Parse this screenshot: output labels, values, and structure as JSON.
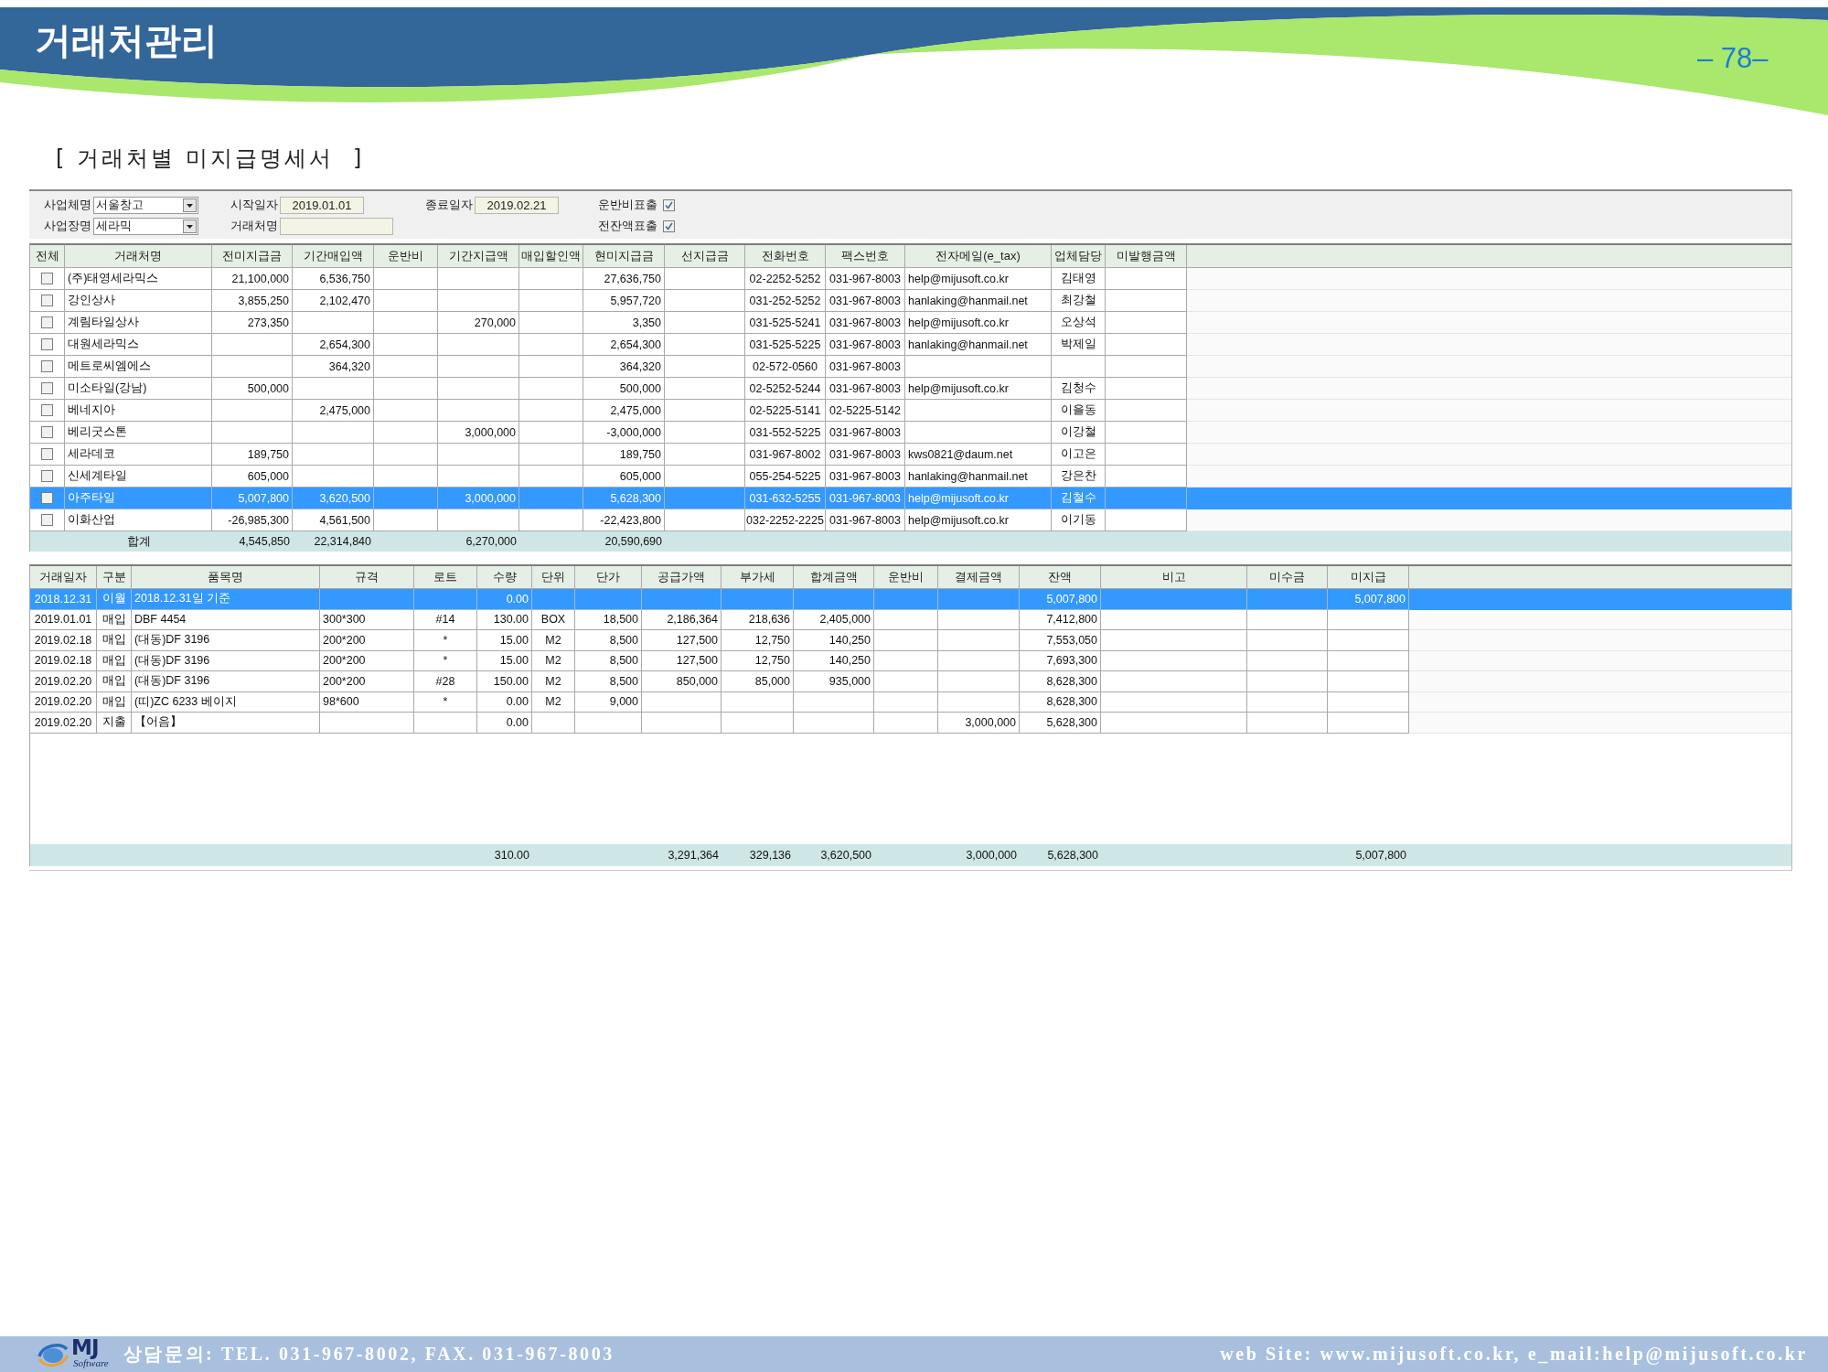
{
  "header": {
    "title": "거래처관리",
    "page_number": "– 78–"
  },
  "section_title": "[ 거래처별 미지급명세서  ]",
  "filter_columns": [
    {
      "fields": [
        {
          "kind": "combo",
          "label": "사업체명",
          "value": "서울창고"
        },
        {
          "kind": "combo",
          "label": "사업장명",
          "value": "세라믹"
        }
      ]
    },
    {
      "fields": [
        {
          "kind": "date",
          "label": "시작일자",
          "value": "2019.01.01"
        },
        {
          "kind": "text",
          "label": "거래처명"
        }
      ]
    },
    {
      "fields": [
        {
          "kind": "date",
          "label": "종료일자",
          "value": "2019.02.21"
        }
      ]
    },
    {
      "fields": [
        {
          "kind": "checkbox",
          "label": "운반비표출",
          "checked": true
        },
        {
          "kind": "checkbox",
          "label": "전잔액표출",
          "checked": true
        }
      ]
    }
  ],
  "vendor_table": {
    "columns": [
      "전체",
      "거래처명",
      "전미지급금",
      "기간매입액",
      "운반비",
      "기간지급액",
      "매입할인액",
      "현미지급금",
      "선지급금",
      "전화번호",
      "팩스번호",
      "전자메일(e_tax)",
      "업체담당",
      "미발행금액"
    ],
    "rows": [
      {
        "checked": false,
        "selected": false,
        "cells": [
          "",
          "(주)태영세라믹스",
          "21,100,000",
          "6,536,750",
          "",
          "",
          "",
          "27,636,750",
          "",
          "02-2252-5252",
          "031-967-8003",
          "help@mijusoft.co.kr",
          "김태영",
          ""
        ]
      },
      {
        "checked": false,
        "selected": false,
        "cells": [
          "",
          "강인상사",
          "3,855,250",
          "2,102,470",
          "",
          "",
          "",
          "5,957,720",
          "",
          "031-252-5252",
          "031-967-8003",
          "hanlaking@hanmail.net",
          "최강철",
          ""
        ]
      },
      {
        "checked": false,
        "selected": false,
        "cells": [
          "",
          "계림타일상사",
          "273,350",
          "",
          "",
          "270,000",
          "",
          "3,350",
          "",
          "031-525-5241",
          "031-967-8003",
          "help@mijusoft.co.kr",
          "오상석",
          ""
        ]
      },
      {
        "checked": false,
        "selected": false,
        "cells": [
          "",
          "대원세라믹스",
          "",
          "2,654,300",
          "",
          "",
          "",
          "2,654,300",
          "",
          "031-525-5225",
          "031-967-8003",
          "hanlaking@hanmail.net",
          "박제일",
          ""
        ]
      },
      {
        "checked": false,
        "selected": false,
        "cells": [
          "",
          "메트로씨엠에스",
          "",
          "364,320",
          "",
          "",
          "",
          "364,320",
          "",
          "02-572-0560",
          "031-967-8003",
          "",
          "",
          ""
        ]
      },
      {
        "checked": false,
        "selected": false,
        "cells": [
          "",
          "미소타일(강남)",
          "500,000",
          "",
          "",
          "",
          "",
          "500,000",
          "",
          "02-5252-5244",
          "031-967-8003",
          "help@mijusoft.co.kr",
          "김청수",
          ""
        ]
      },
      {
        "checked": false,
        "selected": false,
        "cells": [
          "",
          "베네지아",
          "",
          "2,475,000",
          "",
          "",
          "",
          "2,475,000",
          "",
          "02-5225-5141",
          "02-5225-5142",
          "",
          "이을동",
          ""
        ]
      },
      {
        "checked": false,
        "selected": false,
        "cells": [
          "",
          "베리굿스톤",
          "",
          "",
          "",
          "3,000,000",
          "",
          "-3,000,000",
          "",
          "031-552-5225",
          "031-967-8003",
          "",
          "이강철",
          ""
        ]
      },
      {
        "checked": false,
        "selected": false,
        "cells": [
          "",
          "세라데코",
          "189,750",
          "",
          "",
          "",
          "",
          "189,750",
          "",
          "031-967-8002",
          "031-967-8003",
          "kws0821@daum.net",
          "이고은",
          ""
        ]
      },
      {
        "checked": false,
        "selected": false,
        "cells": [
          "",
          "신세계타일",
          "605,000",
          "",
          "",
          "",
          "",
          "605,000",
          "",
          "055-254-5225",
          "031-967-8003",
          "hanlaking@hanmail.net",
          "강은찬",
          ""
        ]
      },
      {
        "checked": false,
        "selected": true,
        "cells": [
          "",
          "아주타일",
          "5,007,800",
          "3,620,500",
          "",
          "3,000,000",
          "",
          "5,628,300",
          "",
          "031-632-5255",
          "031-967-8003",
          "help@mijusoft.co.kr",
          "김철수",
          ""
        ]
      },
      {
        "checked": false,
        "selected": false,
        "cells": [
          "",
          "이화산업",
          "-26,985,300",
          "4,561,500",
          "",
          "",
          "",
          "-22,423,800",
          "",
          "032-2252-2225",
          "031-967-8003",
          "help@mijusoft.co.kr",
          "이기동",
          ""
        ]
      }
    ],
    "total_row": {
      "cells": [
        "",
        "합계",
        "4,545,850",
        "22,314,840",
        "",
        "6,270,000",
        "",
        "20,590,690",
        "",
        "",
        "",
        "",
        "",
        ""
      ]
    }
  },
  "ledger_table": {
    "columns": [
      "거래일자",
      "구분",
      "품목명",
      "규격",
      "로트",
      "수량",
      "단위",
      "단가",
      "공급가액",
      "부가세",
      "합계금액",
      "운반비",
      "결제금액",
      "잔액",
      "비고",
      "미수금",
      "미지급"
    ],
    "rows": [
      {
        "selected": true,
        "cells": [
          "2018.12.31",
          "이월",
          "2018.12.31일 기준",
          "",
          "",
          "0.00",
          "",
          "",
          "",
          "",
          "",
          "",
          "",
          "5,007,800",
          "",
          "",
          "5,007,800"
        ]
      },
      {
        "selected": false,
        "cells": [
          "2019.01.01",
          "매입",
          "DBF 4454",
          "300*300",
          "#14",
          "130.00",
          "BOX",
          "18,500",
          "2,186,364",
          "218,636",
          "2,405,000",
          "",
          "",
          "7,412,800",
          "",
          "",
          ""
        ]
      },
      {
        "selected": false,
        "cells": [
          "2019.02.18",
          "매입",
          "(대동)DF 3196",
          "200*200",
          "*",
          "15.00",
          "M2",
          "8,500",
          "127,500",
          "12,750",
          "140,250",
          "",
          "",
          "7,553,050",
          "",
          "",
          ""
        ]
      },
      {
        "selected": false,
        "cells": [
          "2019.02.18",
          "매입",
          "(대동)DF 3196",
          "200*200",
          "*",
          "15.00",
          "M2",
          "8,500",
          "127,500",
          "12,750",
          "140,250",
          "",
          "",
          "7,693,300",
          "",
          "",
          ""
        ]
      },
      {
        "selected": false,
        "cells": [
          "2019.02.20",
          "매입",
          "(대동)DF 3196",
          "200*200",
          "#28",
          "150.00",
          "M2",
          "8,500",
          "850,000",
          "85,000",
          "935,000",
          "",
          "",
          "8,628,300",
          "",
          "",
          ""
        ]
      },
      {
        "selected": false,
        "cells": [
          "2019.02.20",
          "매입",
          "(띠)ZC 6233 베이지",
          "98*600",
          "*",
          "0.00",
          "M2",
          "9,000",
          "",
          "",
          "",
          "",
          "",
          "8,628,300",
          "",
          "",
          ""
        ]
      },
      {
        "selected": false,
        "cells": [
          "2019.02.20",
          "지출",
          "【어음】",
          "",
          "",
          "0.00",
          "",
          "",
          "",
          "",
          "",
          "",
          "3,000,000",
          "5,628,300",
          "",
          "",
          ""
        ]
      }
    ],
    "total_row": {
      "cells": [
        "",
        "",
        "",
        "",
        "",
        "310.00",
        "",
        "",
        "3,291,364",
        "329,136",
        "3,620,500",
        "",
        "3,000,000",
        "5,628,300",
        "",
        "",
        "5,007,800"
      ]
    }
  },
  "footer": {
    "logo_text": "MJ",
    "logo_subtext": "Software",
    "contact": "상담문의: TEL. 031-967-8002, FAX. 031-967-8003",
    "website": "web Site: www.mijusoft.co.kr, e_mail:help@mijusoft.co.kr"
  }
}
